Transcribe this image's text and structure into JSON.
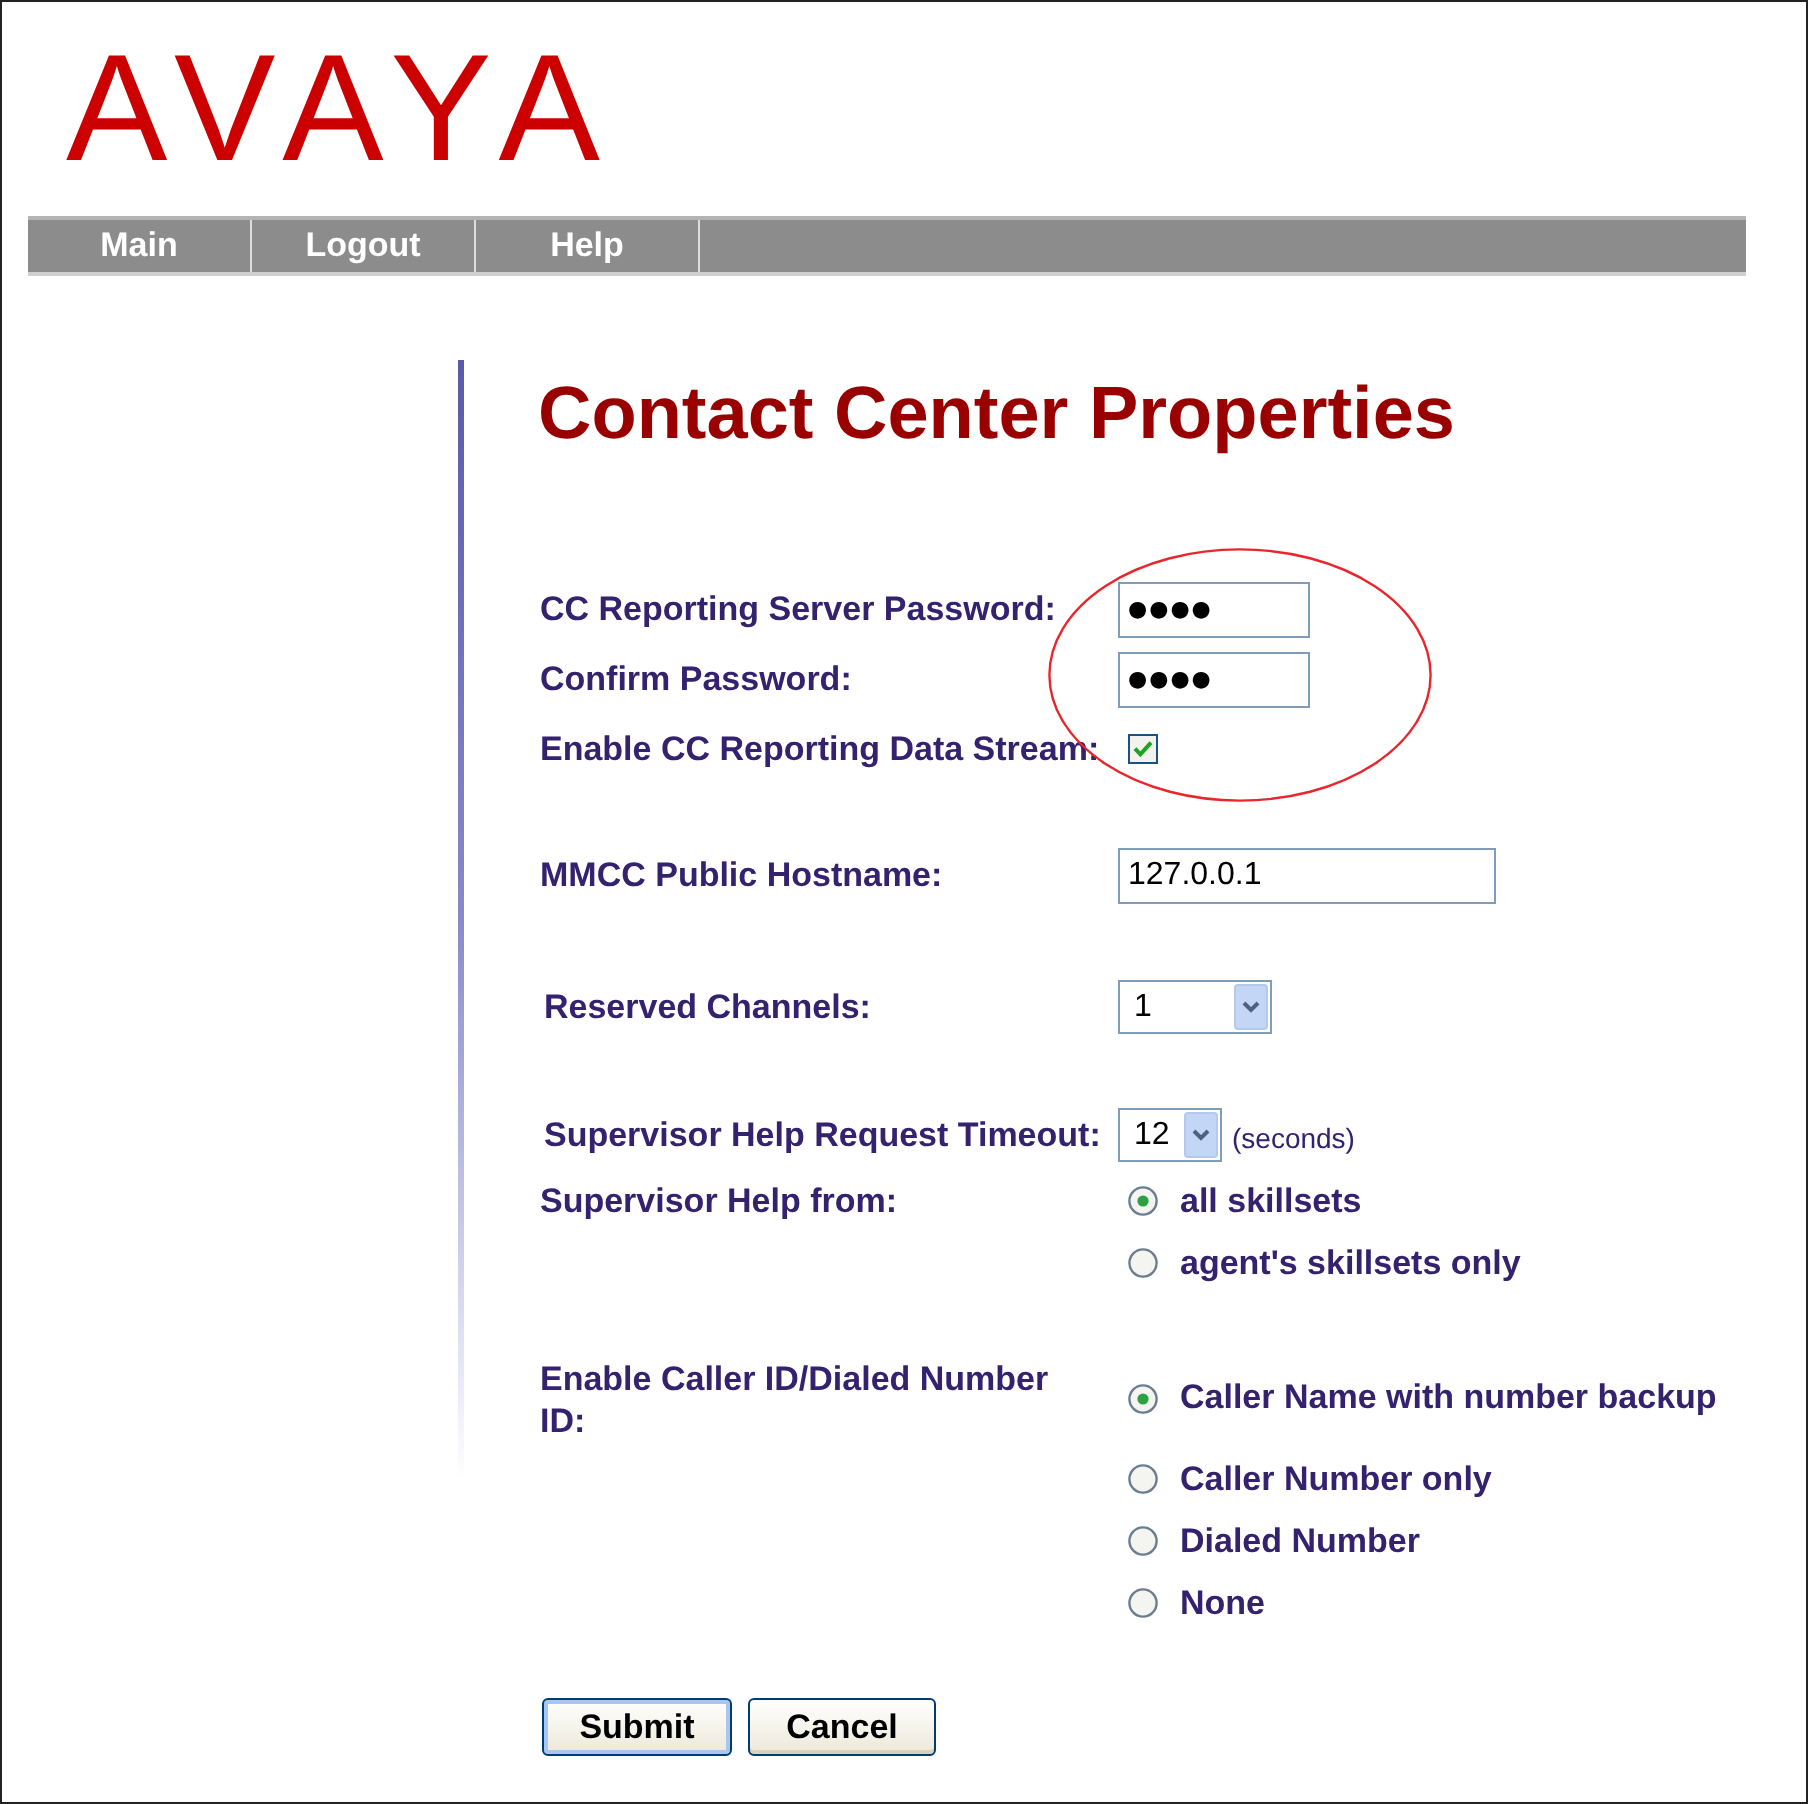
{
  "logo": {
    "text": "AVAYA"
  },
  "nav": [
    {
      "label": "Main"
    },
    {
      "label": "Logout"
    },
    {
      "label": "Help"
    }
  ],
  "title": "Contact Center Properties",
  "sections": [
    {
      "highlighted": true,
      "fields": [
        {
          "kind": "password",
          "label": "CC Reporting Server Password:",
          "value": "●●●●"
        },
        {
          "kind": "password",
          "label": "Confirm Password:",
          "value": "●●●●"
        },
        {
          "kind": "checkbox",
          "label": "Enable CC Reporting Data Stream:",
          "checked": true
        }
      ]
    },
    {
      "highlighted": false,
      "fields": [
        {
          "kind": "text",
          "label": "MMCC Public Hostname:",
          "value": "127.0.0.1"
        }
      ]
    },
    {
      "highlighted": false,
      "fields": [
        {
          "kind": "select",
          "label": "Reserved Channels:",
          "value": "1"
        }
      ]
    },
    {
      "highlighted": false,
      "fields": [
        {
          "kind": "select",
          "label": "Supervisor Help Request Timeout:",
          "value": "12",
          "unit": "(seconds)"
        },
        {
          "kind": "radio",
          "label": "Supervisor Help from:",
          "options": [
            {
              "label": "all skillsets",
              "selected": true
            },
            {
              "label": "agent's skillsets only",
              "selected": false
            }
          ]
        }
      ]
    },
    {
      "highlighted": false,
      "fields": [
        {
          "kind": "radio",
          "label": "Enable Caller ID/Dialed Number ID:",
          "options": [
            {
              "label": "Caller Name with number backup",
              "selected": true
            },
            {
              "label": "Caller Number only",
              "selected": false
            },
            {
              "label": "Dialed Number",
              "selected": false
            },
            {
              "label": "None",
              "selected": false
            }
          ]
        }
      ]
    }
  ],
  "buttons": [
    {
      "label": "Submit",
      "default": true
    },
    {
      "label": "Cancel",
      "default": false
    }
  ]
}
